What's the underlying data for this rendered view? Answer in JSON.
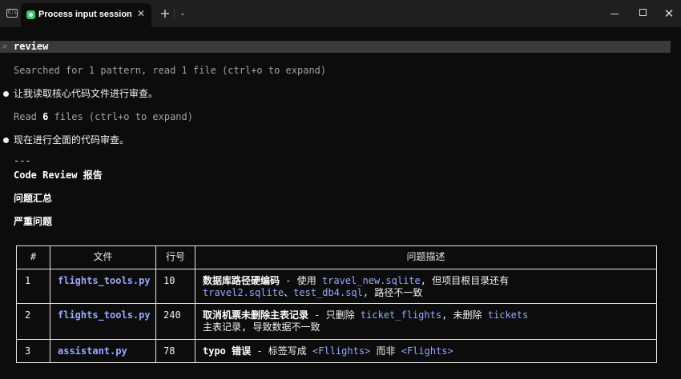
{
  "window": {
    "tab_title": "Process input session",
    "shell_icon_text": "C:\\",
    "close_glyph": "✕",
    "new_tab_glyph": "+",
    "dropdown_glyph": "⌄",
    "win_close_glyph": "✕",
    "status_color": "#2ecc71"
  },
  "prompt": {
    "caret": ">",
    "text": "review"
  },
  "log": {
    "searched": "Searched for 1 pattern, read 1 file (ctrl+o to expand)",
    "msg1": "让我读取核心代码文件进行审查。",
    "read_prefix": "Read ",
    "read_count": "6",
    "read_suffix": " files (ctrl+o to expand)",
    "msg2": "现在进行全面的代码审查。",
    "divider": "---",
    "report_title": "Code Review 报告",
    "summary": "问题汇总",
    "severe": "严重问题"
  },
  "table": {
    "headers": [
      "#",
      "文件",
      "行号",
      "问题描述"
    ],
    "rows": [
      {
        "num": "1",
        "file": "flights_tools.py",
        "line": "10",
        "desc": {
          "title": "数据库路径硬编码",
          "sep": " - 使用 ",
          "code1": "travel_new.sqlite",
          "mid": ", 但项目根目录还有",
          "code2": "travel2.sqlite",
          "mid2": "、",
          "code3": "test_db4.sql",
          "tail": ", 路径不一致"
        }
      },
      {
        "num": "2",
        "file": "flights_tools.py",
        "line": "240",
        "desc": {
          "title": "取消机票未删除主表记录",
          "sep": " - 只删除 ",
          "code1": "ticket_flights",
          "mid": ", 未删除 ",
          "code2": "tickets",
          "tail": "主表记录, 导致数据不一致"
        }
      },
      {
        "num": "3",
        "file": "assistant.py",
        "line": "78",
        "desc": {
          "title": "typo 错误",
          "sep": " - 标签写成 ",
          "code1": "<Fllights>",
          "mid": " 而非 ",
          "code2": "<Flights>"
        }
      }
    ]
  }
}
